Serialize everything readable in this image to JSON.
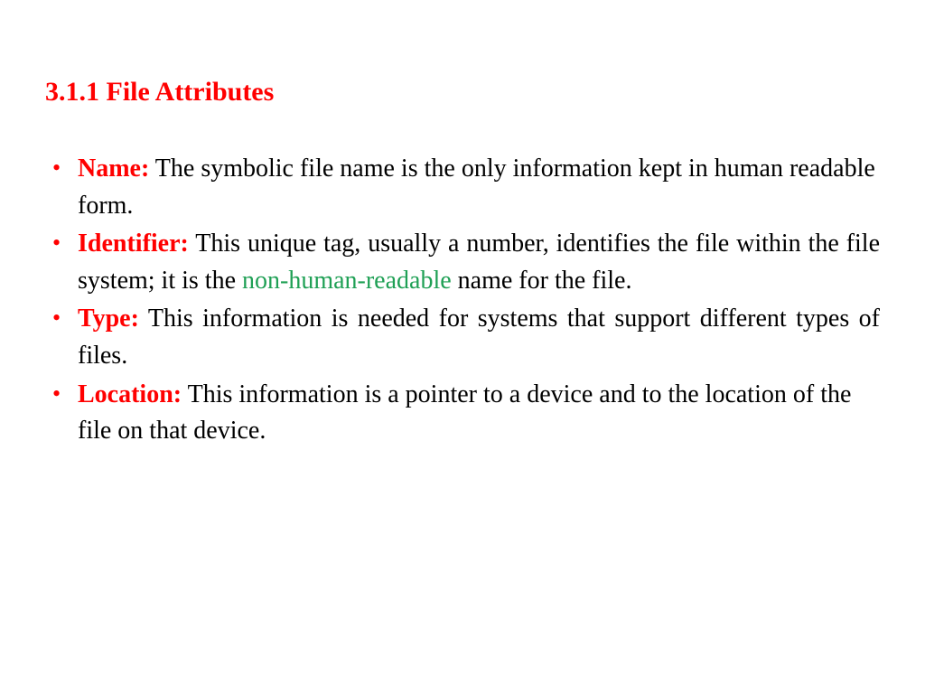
{
  "heading": "3.1.1 File Attributes",
  "items": [
    {
      "label": "Name:",
      "before": "  The symbolic file name is the only information kept in human readable form.",
      "highlight": "",
      "after": "",
      "justify": false
    },
    {
      "label": "Identifier:",
      "before": "  This unique tag, usually a number, identifies the file within the file system; it is the ",
      "highlight": "non-human-readable",
      "after": " name for the file.",
      "justify": true
    },
    {
      "label": "Type:",
      "before": "  This information is needed for systems that support different types of files.",
      "highlight": "",
      "after": "",
      "justify": true
    },
    {
      "label": "Location:",
      "before": "  This information is a pointer to a device and to the location of the file on that device.",
      "highlight": "",
      "after": "",
      "justify": false
    }
  ]
}
